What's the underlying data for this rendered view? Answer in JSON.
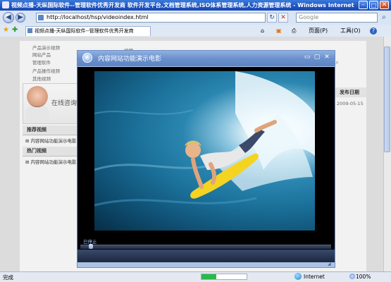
{
  "window": {
    "title": "视频点播-天纵国际软件--管理软件优秀开发商 软件开发平台,文档管理系统,ISO体系管理系统,人力资源管理系统 - Windows Internet Expl...",
    "buttons": {
      "minimize": "–",
      "maximize": "□",
      "close": "✕"
    }
  },
  "address_bar": {
    "url": "http://localhost/hsp/videoindex.html",
    "search_placeholder": "Google",
    "back": "◀",
    "forward": "▶",
    "refresh": "↻",
    "stop": "✕",
    "search_icon": "⌕"
  },
  "tab": {
    "label": "视频点播-天纵国际软件--管理软件优秀开发商"
  },
  "command_bar": {
    "home": "⌂",
    "feeds": "▣",
    "print": "⎙",
    "page_menu": "页面(P)",
    "tools_menu": "工具(O)",
    "help": "?"
  },
  "page": {
    "sidebar_links": [
      "产品演示视频",
      "网站产品",
      "管理软件",
      "产品操作视频",
      "其他视频"
    ],
    "consult_label": "在线咨询",
    "sections": [
      {
        "title": "推荐视频",
        "items": [
          "内容网站功能演示电影"
        ]
      },
      {
        "title": "热门视频",
        "items": [
          "内容网站功能演示电影"
        ]
      }
    ],
    "right_col_header": "发布日期",
    "right_col_date": "2009-05-15",
    "small_label": "视频"
  },
  "popup": {
    "title": "内容网站功能演示电影",
    "status": "已停止",
    "buttons": {
      "minimize": "▭",
      "maximize": "▢",
      "close": "✕"
    }
  },
  "status_bar": {
    "done": "完成",
    "zone": "Internet",
    "zoom": "100%",
    "progress": 0.33
  }
}
